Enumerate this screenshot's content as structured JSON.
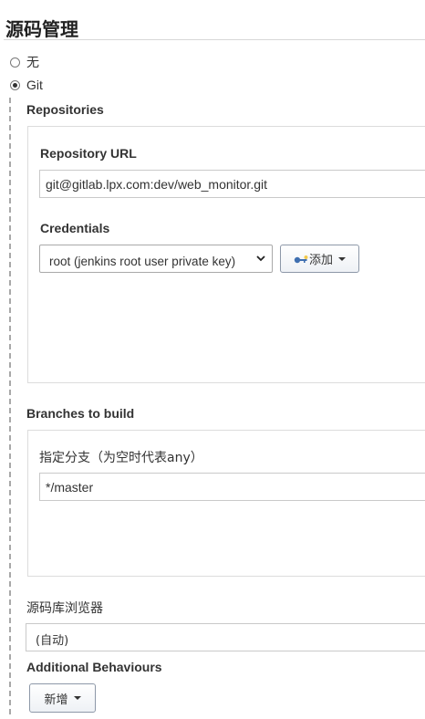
{
  "section": {
    "title": "源码管理"
  },
  "scm_options": [
    {
      "label": "无",
      "checked": false
    },
    {
      "label": "Git",
      "checked": true
    }
  ],
  "repositories": {
    "heading": "Repositories",
    "url_label": "Repository URL",
    "url_value": "git@gitlab.lpx.com:dev/web_monitor.git",
    "credentials_label": "Credentials",
    "credentials_selected": "root (jenkins root user private key)",
    "add_button": "添加",
    "add_icon": "key-icon"
  },
  "branches": {
    "heading": "Branches to build",
    "branch_label": "指定分支（为空时代表any）",
    "branch_value": "*/master"
  },
  "browser": {
    "label": "源码库浏览器",
    "selected": "(自动)"
  },
  "additional": {
    "heading": "Additional Behaviours",
    "add_button": "新增"
  }
}
